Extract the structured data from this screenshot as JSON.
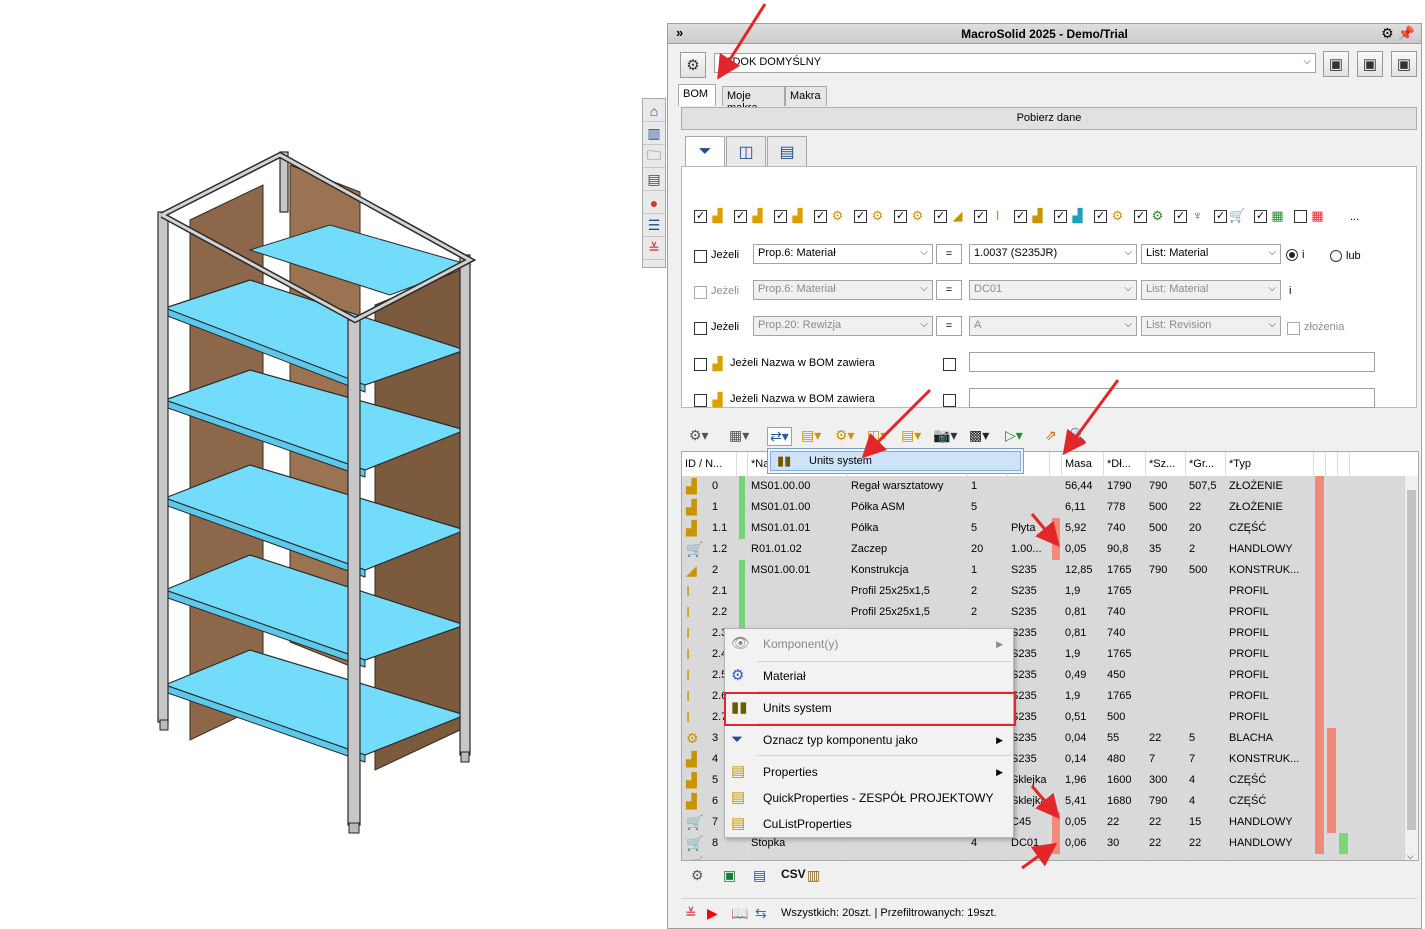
{
  "window": {
    "title": "MacroSolid 2025 - Demo/Trial"
  },
  "view": {
    "selected": "WIDOK DOMYŚLNY"
  },
  "tabs": [
    "BOM",
    "Moje makra",
    "Makra"
  ],
  "fetch_button": "Pobierz dane",
  "filters": {
    "rows": [
      {
        "if_label": "Jeżeli",
        "prop": "Prop.6: Materiał",
        "op": "=",
        "value": "1.0037 (S235JR)",
        "list": "List: Material",
        "radio1": "i",
        "radio2": "lub",
        "enabled": true
      },
      {
        "if_label": "Jeżeli",
        "prop": "Prop.6: Materiał",
        "op": "=",
        "value": "DC01",
        "list": "List: Material",
        "suffix": "i",
        "enabled": false
      },
      {
        "if_label": "Jeżeli",
        "prop": "Prop.20: Rewizja",
        "op": "=",
        "value": "A",
        "list": "List: Revision",
        "suffix": "złożenia",
        "enabled": false
      }
    ],
    "name_filter_label": "Jeżeli Nazwa w BOM zawiera",
    "type_row_tail": "..."
  },
  "dropdown_item": "Units system",
  "grid": {
    "headers": [
      "ID / N...",
      "",
      "*Na",
      "",
      "",
      "at",
      "",
      "Masa",
      "*Dł...",
      "*Sz...",
      "*Gr...",
      "*Typ"
    ],
    "rows": [
      {
        "id": "0",
        "icon": "asm",
        "number": "MS01.00.00",
        "name": "Regał warsztatowy",
        "qty": "1",
        "mat": "",
        "mass": "56,44",
        "len": "1790",
        "wid": "790",
        "thk": "507,5",
        "type": "ZŁOŻENIE",
        "green": true,
        "flags": [
          "r",
          "",
          ""
        ]
      },
      {
        "id": "1",
        "icon": "asm",
        "number": "MS01.01.00",
        "name": "Półka ASM",
        "qty": "5",
        "mat": "",
        "mass": "6,11",
        "len": "778",
        "wid": "500",
        "thk": "22",
        "type": "ZŁOŻENIE",
        "green": true,
        "flags": [
          "r",
          "",
          ""
        ]
      },
      {
        "id": "1.1",
        "icon": "part",
        "number": "MS01.01.01",
        "name": "Półka",
        "qty": "5",
        "mat": "Płyta",
        "mass": "5,92",
        "len": "740",
        "wid": "500",
        "thk": "20",
        "type": "CZĘŚĆ",
        "green": true,
        "flags": [
          "r",
          "",
          ""
        ],
        "matflag": "r"
      },
      {
        "id": "1.2",
        "icon": "cart",
        "number": "R01.01.02",
        "name": "Zaczep",
        "qty": "20",
        "mat": "1.00...",
        "mass": "0,05",
        "len": "90,8",
        "wid": "35",
        "thk": "2",
        "type": "HANDLOWY",
        "green": false,
        "flags": [
          "r",
          "",
          ""
        ],
        "matflag": "r"
      },
      {
        "id": "2",
        "icon": "weld",
        "number": "MS01.00.01",
        "name": "Konstrukcja",
        "qty": "1",
        "mat": "S235",
        "mass": "12,85",
        "len": "1765",
        "wid": "790",
        "thk": "500",
        "type": "KONSTRUK...",
        "green": true,
        "flags": [
          "r",
          "",
          ""
        ]
      },
      {
        "id": "2.1",
        "icon": "beam",
        "number": "",
        "name": "Profil 25x25x1,5",
        "qty": "2",
        "mat": "S235",
        "mass": "1,9",
        "len": "1765",
        "wid": "",
        "thk": "",
        "type": "PROFIL",
        "green": true,
        "flags": [
          "r",
          "",
          ""
        ]
      },
      {
        "id": "2.2",
        "icon": "beam",
        "number": "",
        "name": "Profil 25x25x1,5",
        "qty": "2",
        "mat": "S235",
        "mass": "0,81",
        "len": "740",
        "wid": "",
        "thk": "",
        "type": "PROFIL",
        "green": true,
        "flags": [
          "r",
          "",
          ""
        ]
      },
      {
        "id": "2.3",
        "icon": "beam",
        "number": "",
        "name": "Profil 25x25x1,5",
        "qty": "2",
        "mat": "S235",
        "mass": "0,81",
        "len": "740",
        "wid": "",
        "thk": "",
        "type": "PROFIL",
        "green": true,
        "flags": [
          "r",
          "",
          ""
        ]
      },
      {
        "id": "2.4",
        "icon": "beam",
        "number": "",
        "name": "",
        "qty": "",
        "mat": "S235",
        "mass": "1,9",
        "len": "1765",
        "wid": "",
        "thk": "",
        "type": "PROFIL",
        "green": true,
        "flags": [
          "r",
          "",
          ""
        ]
      },
      {
        "id": "2.5",
        "icon": "beam",
        "number": "",
        "name": "",
        "qty": "",
        "mat": "S235",
        "mass": "0,49",
        "len": "450",
        "wid": "",
        "thk": "",
        "type": "PROFIL",
        "green": true,
        "flags": [
          "r",
          "",
          ""
        ]
      },
      {
        "id": "2.6",
        "icon": "beam",
        "number": "",
        "name": "",
        "qty": "",
        "mat": "S235",
        "mass": "1,9",
        "len": "1765",
        "wid": "",
        "thk": "",
        "type": "PROFIL",
        "green": true,
        "flags": [
          "r",
          "",
          ""
        ]
      },
      {
        "id": "2.7",
        "icon": "beam",
        "number": "",
        "name": "",
        "qty": "",
        "mat": "S235",
        "mass": "0,51",
        "len": "500",
        "wid": "",
        "thk": "",
        "type": "PROFIL",
        "green": true,
        "flags": [
          "r",
          "",
          ""
        ]
      },
      {
        "id": "3",
        "icon": "sheet",
        "number": "",
        "name": "",
        "qty": "",
        "mat": "S235",
        "mass": "0,04",
        "len": "55",
        "wid": "22",
        "thk": "5",
        "type": "BLACHA",
        "green": true,
        "flags": [
          "r",
          "r",
          ""
        ]
      },
      {
        "id": "4",
        "icon": "part",
        "number": "",
        "name": "",
        "qty": "",
        "mat": "S235",
        "mass": "0,14",
        "len": "480",
        "wid": "7",
        "thk": "7",
        "type": "KONSTRUK...",
        "green": true,
        "flags": [
          "r",
          "r",
          ""
        ]
      },
      {
        "id": "5",
        "icon": "part",
        "number": "",
        "name": "",
        "qty": "",
        "mat": "Sklejka",
        "mass": "1,96",
        "len": "1600",
        "wid": "300",
        "thk": "4",
        "type": "CZĘŚĆ",
        "green": true,
        "flags": [
          "r",
          "r",
          ""
        ]
      },
      {
        "id": "6",
        "icon": "part",
        "number": "",
        "name": "",
        "qty": "",
        "mat": "Sklejka",
        "mass": "5,41",
        "len": "1680",
        "wid": "790",
        "thk": "4",
        "type": "CZĘŚĆ",
        "green": true,
        "flags": [
          "r",
          "r",
          ""
        ]
      },
      {
        "id": "7",
        "icon": "cart",
        "number": "",
        "name": "Wstawka",
        "qty": "4",
        "mat": "C45",
        "mass": "0,05",
        "len": "22",
        "wid": "22",
        "thk": "15",
        "type": "HANDLOWY",
        "green": false,
        "flags": [
          "r",
          "r",
          ""
        ],
        "matflag": "r"
      },
      {
        "id": "8",
        "icon": "cart",
        "number": "Stopka",
        "name": "",
        "qty": "4",
        "mat": "DC01",
        "mass": "0,06",
        "len": "30",
        "wid": "22",
        "thk": "22",
        "type": "HANDLOWY",
        "green": false,
        "flags": [
          "r",
          "",
          "g"
        ],
        "matflag": "r"
      },
      {
        "id": "",
        "icon": "cart",
        "number": "",
        "name": "",
        "qty": "",
        "mat": "",
        "mass": "",
        "len": "",
        "wid": "",
        "thk": "",
        "type": "",
        "green": false,
        "flags": [
          "",
          "",
          ""
        ]
      }
    ]
  },
  "context_menu": {
    "items": [
      {
        "label": "Komponent(y)",
        "icon": "eye",
        "submenu": true,
        "disabled": true
      },
      {
        "label": "Materiał",
        "icon": "material",
        "submenu": false
      },
      {
        "label": "Units system",
        "icon": "units",
        "submenu": false,
        "highlight": true
      },
      {
        "label": "Oznacz typ komponentu jako",
        "icon": "funnel",
        "submenu": true
      },
      {
        "label": "Properties",
        "icon": "props",
        "submenu": true
      },
      {
        "label": "QuickProperties - ZESPÓŁ PROJEKTOWY",
        "icon": "props",
        "submenu": false
      },
      {
        "label": "CuListProperties",
        "icon": "props",
        "submenu": false
      }
    ]
  },
  "bottom_toolbar": {
    "csv": "CSV"
  },
  "status": {
    "text": "Wszystkich: 20szt. | Przefiltrowanych: 19szt."
  },
  "colors": {
    "accent_red": "#e3262a",
    "row_green": "#75d47a",
    "flag_red": "#f08a7a",
    "shelf_blue": "#74dcfb",
    "wood": "#8f6a4a"
  }
}
